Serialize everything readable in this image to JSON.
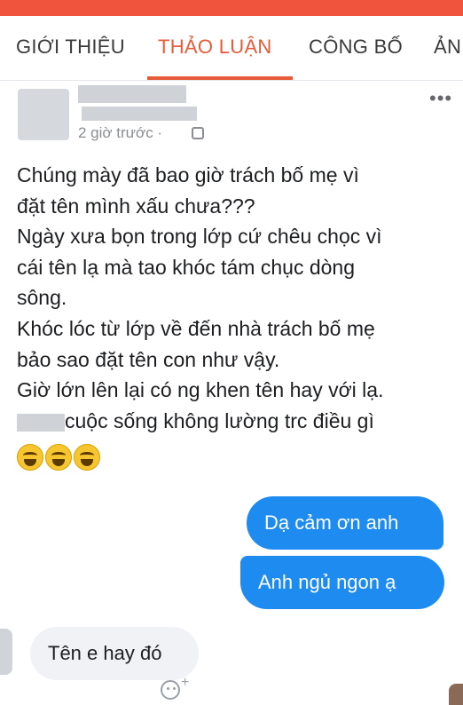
{
  "tabs": [
    {
      "label": "GIỚI THIỆU",
      "active": false
    },
    {
      "label": "THẢO LUẬN",
      "active": true
    },
    {
      "label": "CÔNG BỐ",
      "active": false
    },
    {
      "label": "ẢN",
      "active": false
    }
  ],
  "colors": {
    "accent": "#e85b3a",
    "top_bar": "#f0543c",
    "outgoing_bubble": "#1e8bf1",
    "incoming_bubble": "#f0f2f5"
  },
  "post": {
    "time": "2 giờ trước ·",
    "more_label": "•••",
    "lines": [
      "Chúng mày đã bao giờ trách bố mẹ vì",
      "đặt tên mình xấu chưa???",
      "Ngày xưa bọn trong lớp cứ chêu chọc vì",
      "cái tên lạ mà tao  khóc tám chục dòng",
      "sông.",
      "Khóc lóc từ lớp về đến nhà  trách bố mẹ",
      "bảo sao đặt tên con như vậy.",
      "Giờ lớn lên lại có ng khen tên hay với lạ.",
      "cuộc sống không lường trc điều gì"
    ],
    "emoji_icon": "laughing-crying-emoji",
    "emoji_count": 3
  },
  "chat": {
    "outgoing": [
      "Dạ cảm ơn anh",
      "Anh ngủ ngon ạ"
    ],
    "incoming": [
      "Tên e hay đó"
    ],
    "react_plus": "+"
  }
}
